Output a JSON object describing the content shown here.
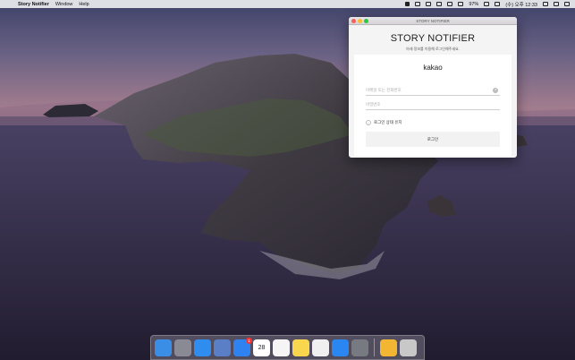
{
  "menubar": {
    "app_name": "Story Notifier",
    "items": [
      "Window",
      "Help"
    ],
    "battery": "97%",
    "clock": "(수) 오후 12:33"
  },
  "window": {
    "title": "STORY NOTIFIER",
    "heading": "STORY NOTIFIER",
    "subtitle": "아래 정보를 이용해 로그인해주세요.",
    "brand": "kakao",
    "email_placeholder": "이메일 또는 전화번호",
    "password_placeholder": "비밀번호",
    "help_label": "?",
    "keep_login_label": "로그인 상태 유지",
    "login_button": "로그인"
  },
  "dock": {
    "items": [
      {
        "name": "finder-icon",
        "color": "#3a8ee6"
      },
      {
        "name": "launchpad-icon",
        "color": "#8a8a94"
      },
      {
        "name": "safari-icon",
        "color": "#2f8df0"
      },
      {
        "name": "mail-icon",
        "color": "#5a7fc7"
      },
      {
        "name": "messages-icon",
        "color": "#2e83f0",
        "badge": "1"
      },
      {
        "name": "calendar-icon",
        "color": "#ffffff",
        "text": "28"
      },
      {
        "name": "reminders-icon",
        "color": "#f5f5f5"
      },
      {
        "name": "notes-icon",
        "color": "#f8d64e"
      },
      {
        "name": "music-icon",
        "color": "#f0f0f0"
      },
      {
        "name": "app-store-icon",
        "color": "#2a86f0"
      },
      {
        "name": "system-preferences-icon",
        "color": "#777a80"
      },
      {
        "name": "story-notifier-icon",
        "color": "#f2b632"
      },
      {
        "name": "trash-icon",
        "color": "#c8c8c8"
      }
    ]
  }
}
